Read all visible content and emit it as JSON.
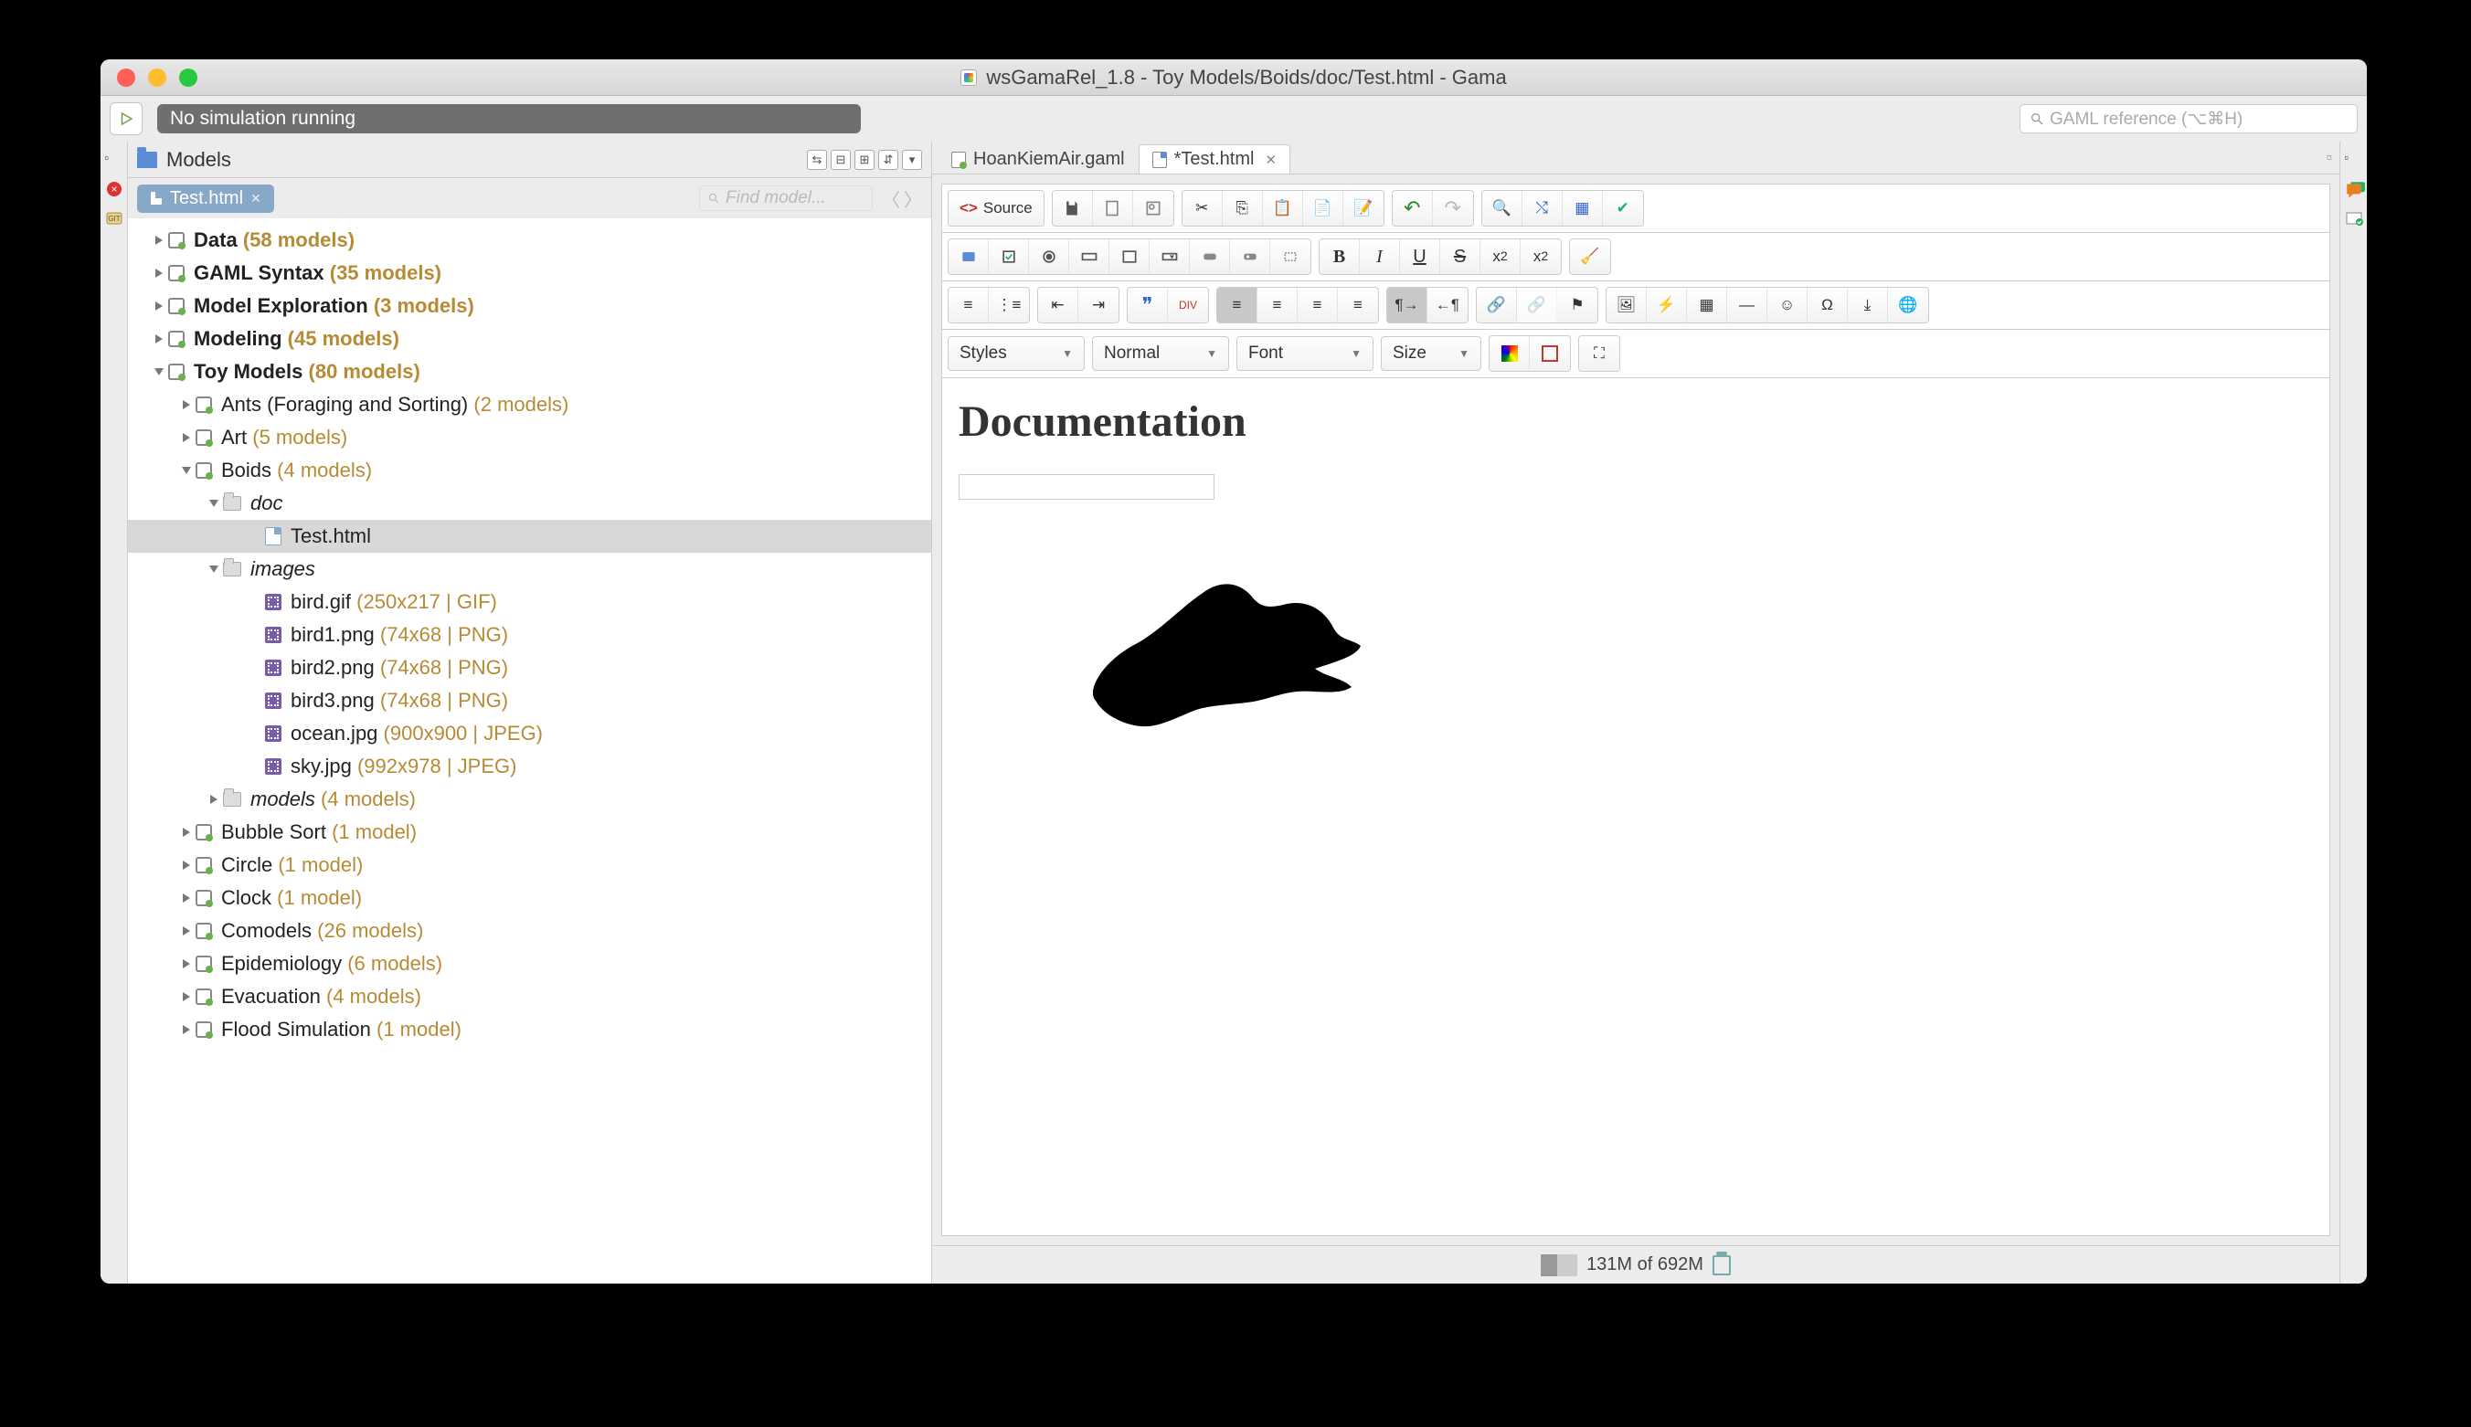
{
  "window": {
    "title": "wsGamaRel_1.8 - Toy Models/Boids/doc/Test.html - Gama"
  },
  "toolbar": {
    "status": "No simulation running",
    "search_placeholder": "GAML reference (⌥⌘H)"
  },
  "models_panel": {
    "title": "Models",
    "breadcrumb": "Test.html",
    "find_placeholder": "Find model...",
    "tree": {
      "data": {
        "label": "Data",
        "count": "(58 models)"
      },
      "gaml": {
        "label": "GAML Syntax",
        "count": "(35 models)"
      },
      "modelexp": {
        "label": "Model Exploration",
        "count": "(3 models)"
      },
      "modeling": {
        "label": "Modeling",
        "count": "(45 models)"
      },
      "toy": {
        "label": "Toy Models",
        "count": "(80 models)"
      },
      "ants": {
        "label": "Ants (Foraging and Sorting)",
        "count": "(2 models)"
      },
      "art": {
        "label": "Art",
        "count": "(5 models)"
      },
      "boids": {
        "label": "Boids",
        "count": "(4 models)"
      },
      "doc": {
        "label": "doc"
      },
      "test_html": {
        "label": "Test.html"
      },
      "images": {
        "label": "images"
      },
      "bird_gif": {
        "label": "bird.gif",
        "meta": "(250x217 | GIF)"
      },
      "bird1": {
        "label": "bird1.png",
        "meta": "(74x68 | PNG)"
      },
      "bird2": {
        "label": "bird2.png",
        "meta": "(74x68 | PNG)"
      },
      "bird3": {
        "label": "bird3.png",
        "meta": "(74x68 | PNG)"
      },
      "ocean": {
        "label": "ocean.jpg",
        "meta": "(900x900 | JPEG)"
      },
      "sky": {
        "label": "sky.jpg",
        "meta": "(992x978 | JPEG)"
      },
      "models_folder": {
        "label": "models",
        "count": "(4 models)"
      },
      "bubble": {
        "label": "Bubble Sort",
        "count": "(1 model)"
      },
      "circle": {
        "label": "Circle",
        "count": "(1 model)"
      },
      "clock": {
        "label": "Clock",
        "count": "(1 model)"
      },
      "comodels": {
        "label": "Comodels",
        "count": "(26 models)"
      },
      "epi": {
        "label": "Epidemiology",
        "count": "(6 models)"
      },
      "evac": {
        "label": "Evacuation",
        "count": "(4 models)"
      },
      "flood": {
        "label": "Flood Simulation",
        "count": "(1 model)"
      }
    }
  },
  "editor": {
    "tabs": {
      "tab1": "HoanKiemAir.gaml",
      "tab2": "*Test.html"
    },
    "source_label": "Source",
    "combos": {
      "styles": "Styles",
      "format": "Normal",
      "font": "Font",
      "size": "Size"
    },
    "content": {
      "heading": "Documentation"
    }
  },
  "status": {
    "heap": "131M of 692M"
  }
}
